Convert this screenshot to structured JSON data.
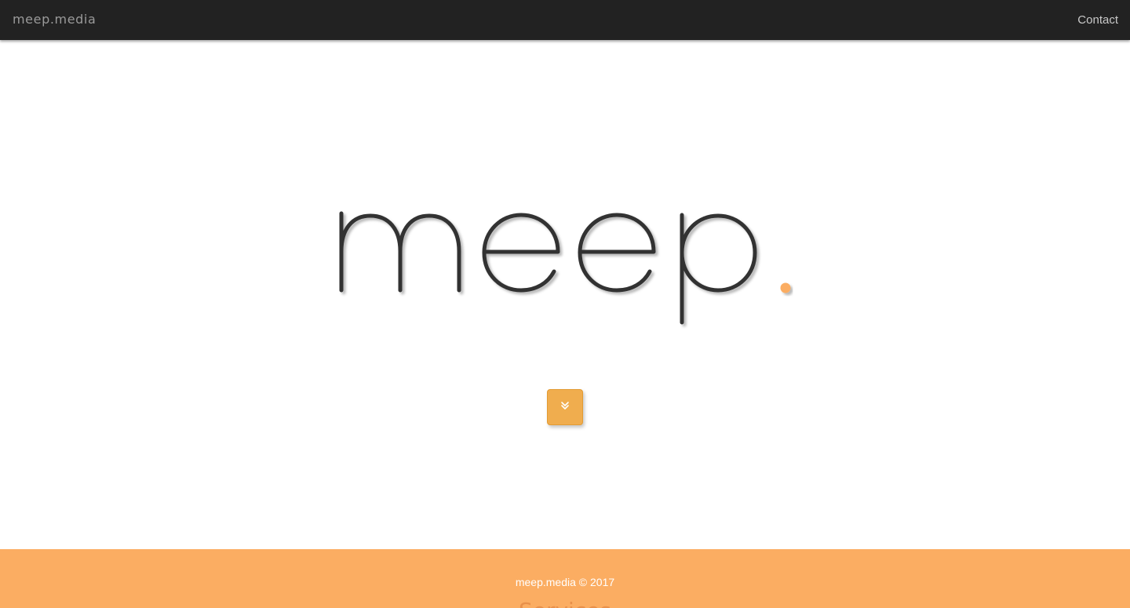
{
  "navbar": {
    "brand": "meep.media",
    "contact_label": "Contact"
  },
  "hero": {
    "logo_text": "meep.",
    "scroll_icon": "double-chevron-down-icon"
  },
  "footer": {
    "copyright": "meep.media © 2017",
    "next_section_title": "Services"
  },
  "colors": {
    "navbar_bg": "#222222",
    "logo_stroke": "#333333",
    "accent_orange": "#fbad62",
    "button_orange": "#f0ad4e"
  }
}
